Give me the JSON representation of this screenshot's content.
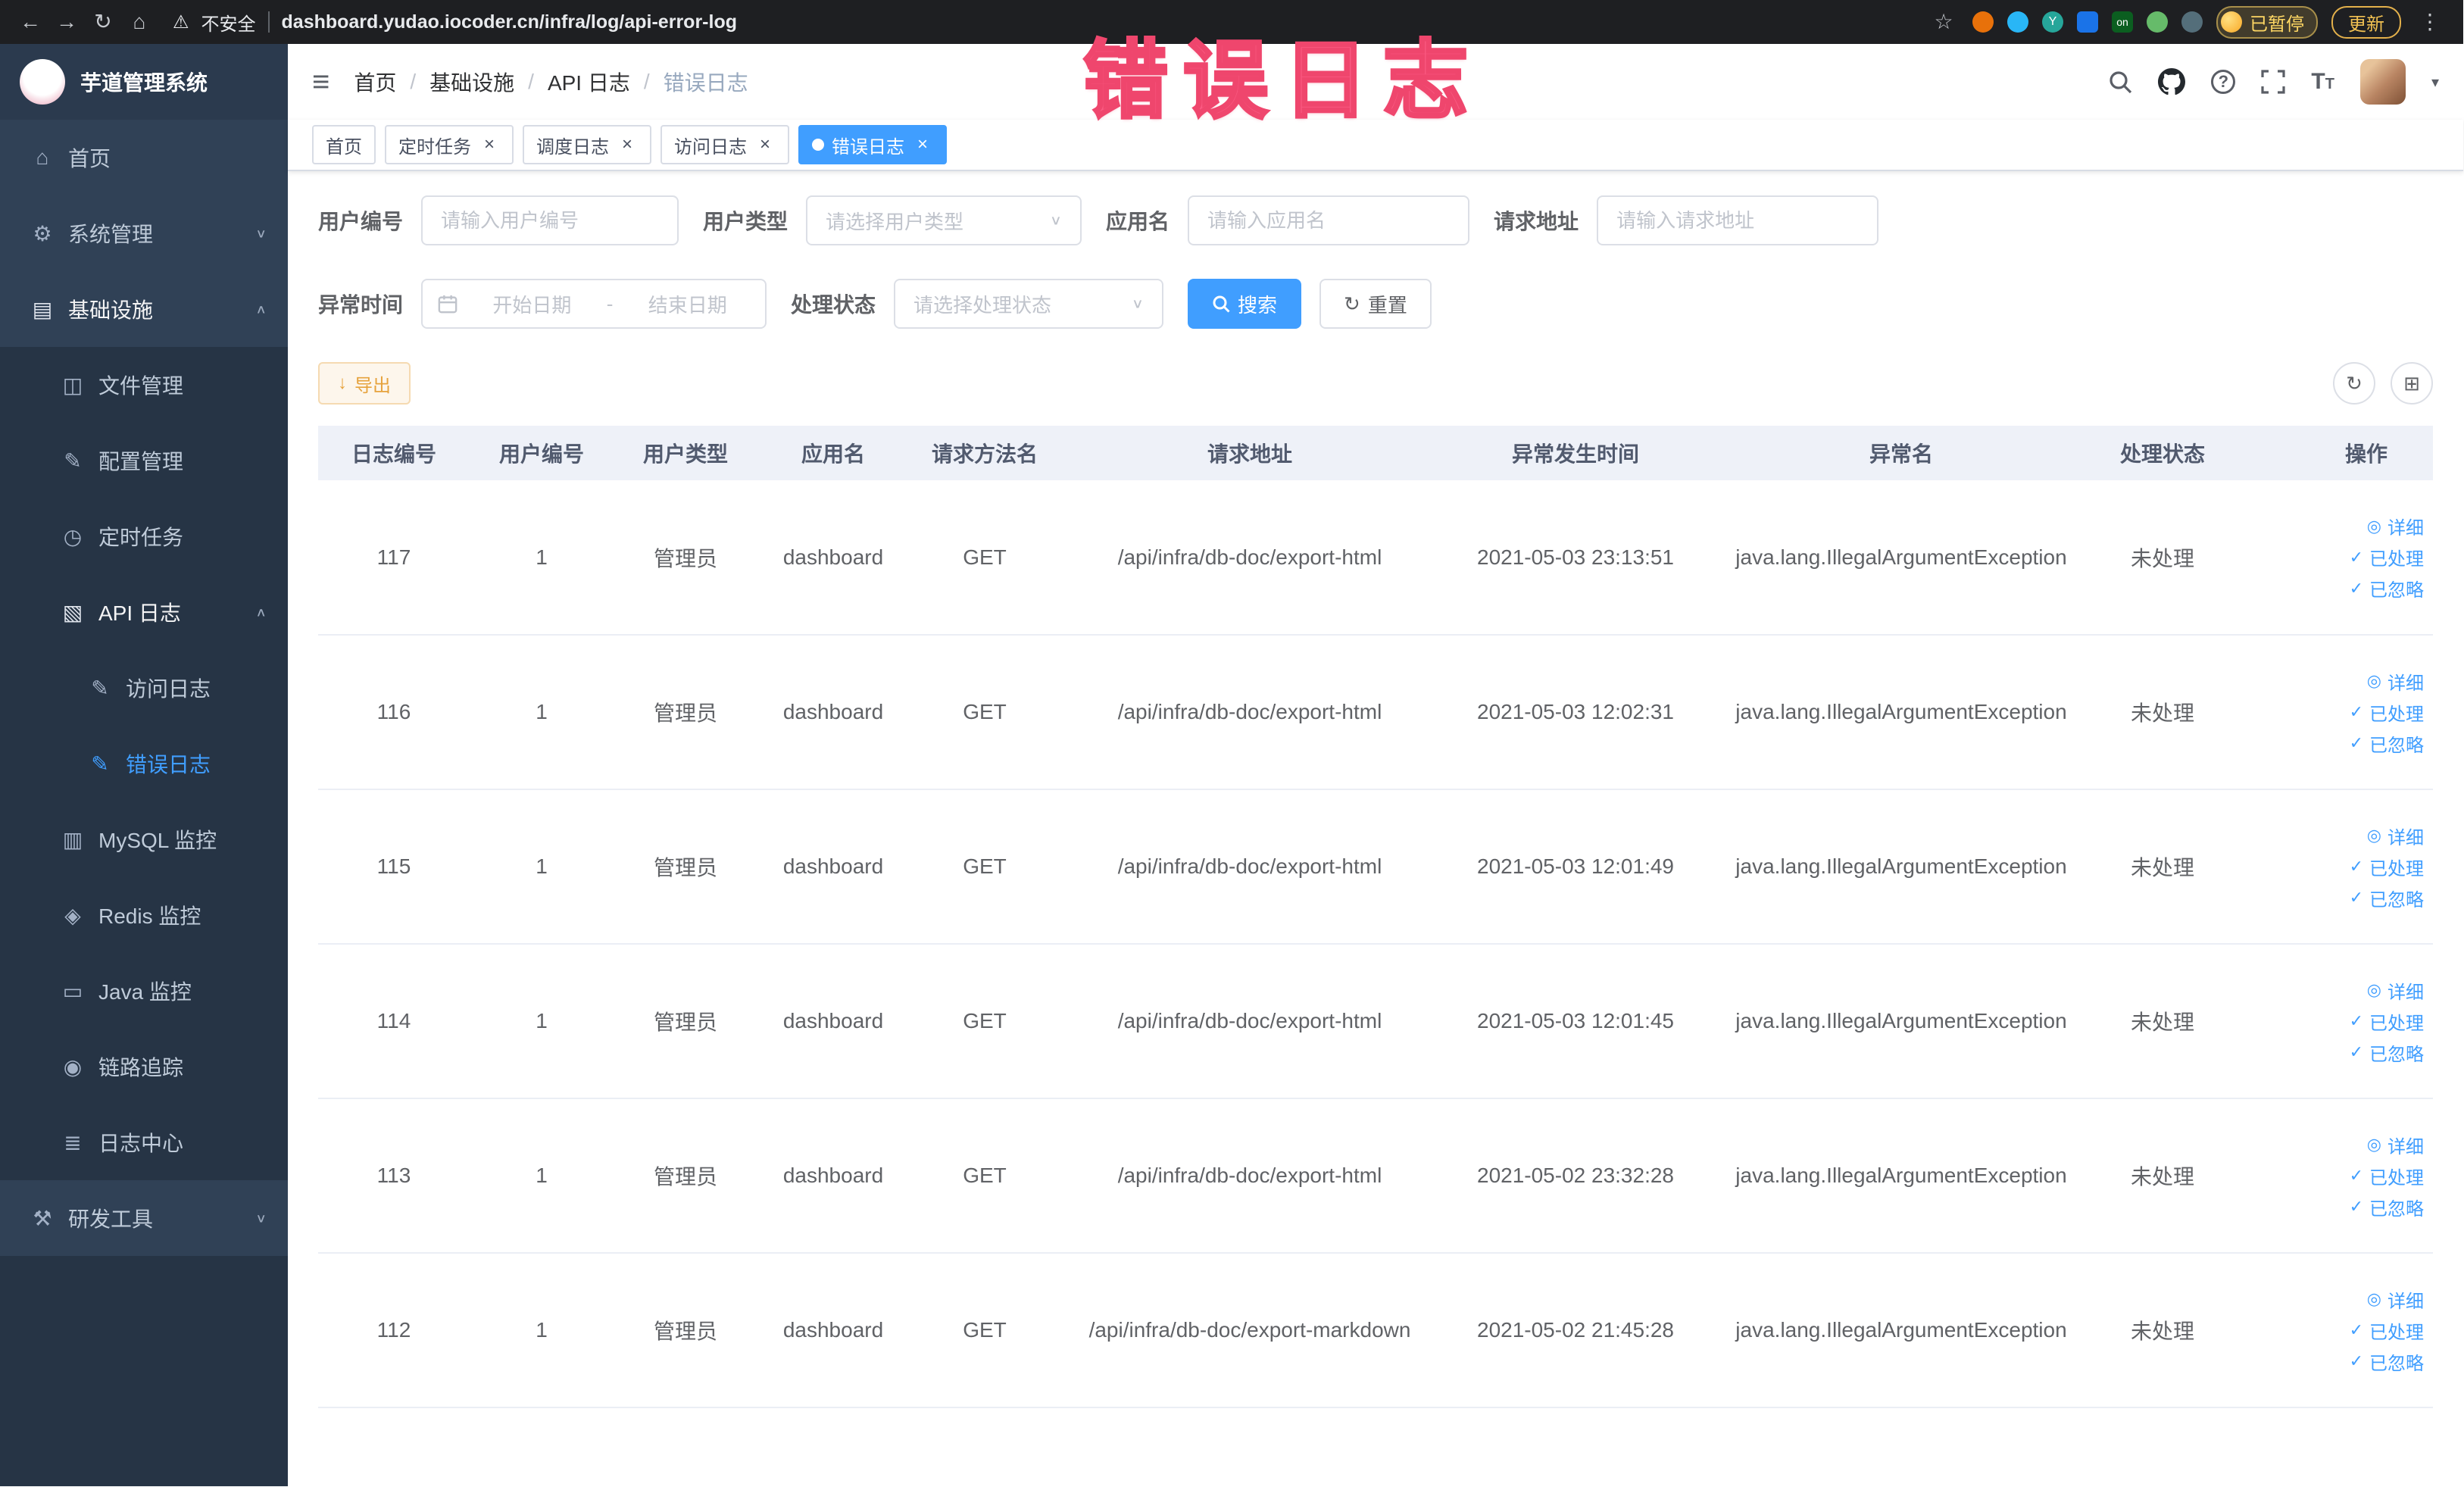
{
  "annotation": {
    "text": "错误日志"
  },
  "browser": {
    "security_warning": "不安全",
    "url": "dashboard.yudao.iocoder.cn/infra/log/api-error-log",
    "profile_badge": "已暂停",
    "update_button": "更新",
    "extension_on_badge": "on"
  },
  "sidebar": {
    "logo": "芋道管理系统",
    "items": [
      {
        "name": "home",
        "label": "首页",
        "icon": "home-icon",
        "level": 1
      },
      {
        "name": "system-management",
        "label": "系统管理",
        "icon": "gear-icon",
        "level": 1,
        "chevron": "down"
      },
      {
        "name": "infrastructure",
        "label": "基础设施",
        "icon": "infra-icon",
        "level": 1,
        "chevron": "up",
        "open": true
      },
      {
        "name": "file-management",
        "label": "文件管理",
        "icon": "file-icon",
        "level": 2
      },
      {
        "name": "config-management",
        "label": "配置管理",
        "icon": "config-icon",
        "level": 2
      },
      {
        "name": "scheduled-jobs",
        "label": "定时任务",
        "icon": "timer-icon",
        "level": 2
      },
      {
        "name": "api-logs",
        "label": "API 日志",
        "icon": "api-log-icon",
        "level": 2,
        "chevron": "up",
        "open": true
      },
      {
        "name": "access-log",
        "label": "访问日志",
        "icon": "access-log-icon",
        "level": 3
      },
      {
        "name": "error-log",
        "label": "错误日志",
        "icon": "error-log-icon",
        "level": 3,
        "active": true
      },
      {
        "name": "mysql-monitor",
        "label": "MySQL 监控",
        "icon": "mysql-icon",
        "level": 2
      },
      {
        "name": "redis-monitor",
        "label": "Redis 监控",
        "icon": "redis-icon",
        "level": 2
      },
      {
        "name": "java-monitor",
        "label": "Java 监控",
        "icon": "java-icon",
        "level": 2
      },
      {
        "name": "trace",
        "label": "链路追踪",
        "icon": "trace-icon",
        "level": 2
      },
      {
        "name": "log-center",
        "label": "日志中心",
        "icon": "log-center-icon",
        "level": 2
      },
      {
        "name": "dev-tools",
        "label": "研发工具",
        "icon": "tools-icon",
        "level": 1,
        "chevron": "down"
      }
    ]
  },
  "header": {
    "breadcrumb": [
      "首页",
      "基础设施",
      "API 日志",
      "错误日志"
    ]
  },
  "tabs": [
    {
      "label": "首页",
      "closable": false,
      "active": false
    },
    {
      "label": "定时任务",
      "closable": true,
      "active": false
    },
    {
      "label": "调度日志",
      "closable": true,
      "active": false
    },
    {
      "label": "访问日志",
      "closable": true,
      "active": false
    },
    {
      "label": "错误日志",
      "closable": true,
      "active": true
    }
  ],
  "filters": {
    "user_id_label": "用户编号",
    "user_id_placeholder": "请输入用户编号",
    "user_type_label": "用户类型",
    "user_type_placeholder": "请选择用户类型",
    "app_name_label": "应用名",
    "app_name_placeholder": "请输入应用名",
    "request_url_label": "请求地址",
    "request_url_placeholder": "请输入请求地址",
    "time_label": "异常时间",
    "time_start_placeholder": "开始日期",
    "time_separator": "-",
    "time_end_placeholder": "结束日期",
    "status_label": "处理状态",
    "status_placeholder": "请选择处理状态",
    "search_button": "搜索",
    "reset_button": "重置"
  },
  "toolbar": {
    "export_button": "导出"
  },
  "table": {
    "columns": [
      "日志编号",
      "用户编号",
      "用户类型",
      "应用名",
      "请求方法名",
      "请求地址",
      "异常发生时间",
      "异常名",
      "处理状态",
      "操作"
    ],
    "rows": [
      {
        "id": "117",
        "user_id": "1",
        "user_type": "管理员",
        "app": "dashboard",
        "method": "GET",
        "url": "/api/infra/db-doc/export-html",
        "time": "2021-05-03 23:13:51",
        "exception": "java.lang.IllegalArgumentException",
        "status": "未处理"
      },
      {
        "id": "116",
        "user_id": "1",
        "user_type": "管理员",
        "app": "dashboard",
        "method": "GET",
        "url": "/api/infra/db-doc/export-html",
        "time": "2021-05-03 12:02:31",
        "exception": "java.lang.IllegalArgumentException",
        "status": "未处理"
      },
      {
        "id": "115",
        "user_id": "1",
        "user_type": "管理员",
        "app": "dashboard",
        "method": "GET",
        "url": "/api/infra/db-doc/export-html",
        "time": "2021-05-03 12:01:49",
        "exception": "java.lang.IllegalArgumentException",
        "status": "未处理"
      },
      {
        "id": "114",
        "user_id": "1",
        "user_type": "管理员",
        "app": "dashboard",
        "method": "GET",
        "url": "/api/infra/db-doc/export-html",
        "time": "2021-05-03 12:01:45",
        "exception": "java.lang.IllegalArgumentException",
        "status": "未处理"
      },
      {
        "id": "113",
        "user_id": "1",
        "user_type": "管理员",
        "app": "dashboard",
        "method": "GET",
        "url": "/api/infra/db-doc/export-html",
        "time": "2021-05-02 23:32:28",
        "exception": "java.lang.IllegalArgumentException",
        "status": "未处理"
      },
      {
        "id": "112",
        "user_id": "1",
        "user_type": "管理员",
        "app": "dashboard",
        "method": "GET",
        "url": "/api/infra/db-doc/export-markdown",
        "time": "2021-05-02 21:45:28",
        "exception": "java.lang.IllegalArgumentException",
        "status": "未处理"
      }
    ],
    "row_actions": [
      "详细",
      "已处理",
      "已忽略"
    ]
  },
  "icons": {
    "back-icon": "←",
    "forward-icon": "→",
    "reload-icon": "↻",
    "home-icon": "⌂",
    "warning-icon": "⚠",
    "star-icon": "☆",
    "menu-dots-icon": "⋮",
    "hamburger-icon": "≡",
    "caret-down-icon": "▾",
    "chevron-down-icon": "∨",
    "chevron-up-icon": "∧",
    "close-icon": "×",
    "gear-icon": "⚙",
    "infra-icon": "▤",
    "file-icon": "◫",
    "config-icon": "✎",
    "timer-icon": "◷",
    "api-log-icon": "▧",
    "access-log-icon": "✎",
    "error-log-icon": "✎",
    "mysql-icon": "▥",
    "redis-icon": "◈",
    "java-icon": "▭",
    "trace-icon": "◉",
    "log-center-icon": "≣",
    "tools-icon": "⚒",
    "eye-icon": "◎",
    "check-icon": "✓",
    "download-icon": "↓",
    "refresh-icon": "↻",
    "column-settings-icon": "⊞"
  }
}
